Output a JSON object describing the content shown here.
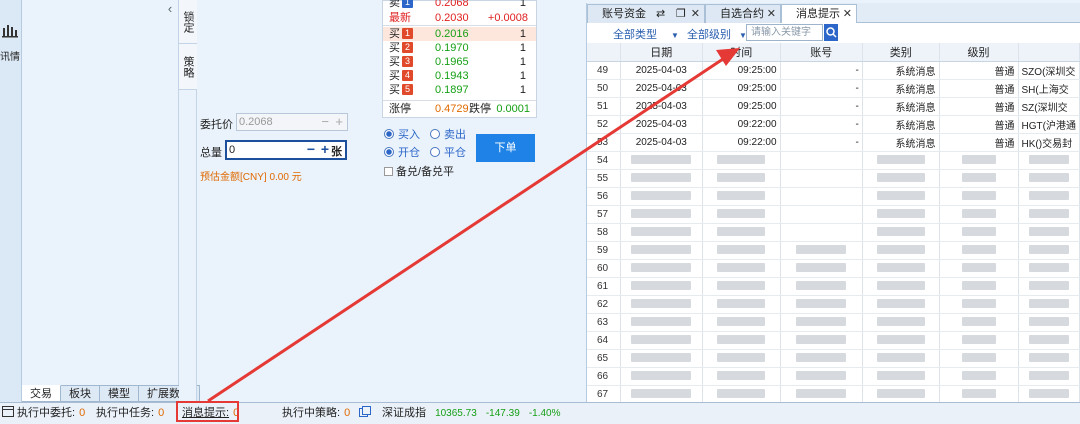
{
  "left_strip": {
    "label": "讯情"
  },
  "left_panel": {
    "bottom_tabs": [
      "交易",
      "板块",
      "模型",
      "扩展数据"
    ]
  },
  "vtabs": [
    "锁定",
    "策略"
  ],
  "order_book": {
    "top_sell": {
      "label": "卖",
      "tag": "1",
      "price": "0.2068",
      "vol": "1"
    },
    "latest": {
      "label": "最新",
      "price": "0.2030",
      "change": "+0.0008"
    },
    "buys": [
      {
        "label": "买",
        "tag": "1",
        "price": "0.2016",
        "vol": "1"
      },
      {
        "label": "买",
        "tag": "2",
        "price": "0.1970",
        "vol": "1"
      },
      {
        "label": "买",
        "tag": "3",
        "price": "0.1965",
        "vol": "1"
      },
      {
        "label": "买",
        "tag": "4",
        "price": "0.1943",
        "vol": "1"
      },
      {
        "label": "买",
        "tag": "5",
        "price": "0.1897",
        "vol": "1"
      }
    ],
    "limit_up_label": "涨停",
    "limit_up": "0.4729",
    "limit_down_label": "跌停",
    "limit_down": "0.0001",
    "colors": {
      "buy_row_bg": "#fde6dc",
      "sell_tag": "#2b66c8",
      "buy_tag": "#e04a2a"
    }
  },
  "order_form": {
    "price_label": "委托价",
    "price_value": "0.2068",
    "qty_label": "总量",
    "qty_value": "0",
    "qty_unit": "张",
    "estimate": "预估金额[CNY] 0.00 元",
    "side_buy": "买入",
    "side_sell": "卖出",
    "open": "开仓",
    "close": "平仓",
    "covered": "备兑/备兑平",
    "submit": "下单"
  },
  "grid": {
    "tabs": [
      "账号资金",
      "自选合约",
      "消息提示"
    ],
    "active_tab": "消息提示",
    "filters": {
      "type": "全部类型",
      "level": "全部级别",
      "search_placeholder": "请输入关键字"
    },
    "columns": [
      "日期",
      "时间",
      "账号",
      "类别",
      "级别",
      ""
    ],
    "rows": [
      {
        "seq": "49",
        "date": "2025-04-03",
        "time": "09:25:00",
        "account": "-",
        "cat": "系统消息",
        "level": "普通",
        "content": "SZO(深圳交"
      },
      {
        "seq": "50",
        "date": "2025-04-03",
        "time": "09:25:00",
        "account": "-",
        "cat": "系统消息",
        "level": "普通",
        "content": "SH(上海交"
      },
      {
        "seq": "51",
        "date": "2025-04-03",
        "time": "09:25:00",
        "account": "-",
        "cat": "系统消息",
        "level": "普通",
        "content": "SZ(深圳交"
      },
      {
        "seq": "52",
        "date": "2025-04-03",
        "time": "09:22:00",
        "account": "-",
        "cat": "系统消息",
        "level": "普通",
        "content": "HGT(沪港通"
      },
      {
        "seq": "53",
        "date": "2025-04-03",
        "time": "09:22:00",
        "account": "-",
        "cat": "系统消息",
        "level": "普通",
        "content": "HK()交易封"
      }
    ],
    "blurred_seqs": [
      "54",
      "55",
      "56",
      "57",
      "58",
      "59",
      "60",
      "61",
      "62",
      "63",
      "64",
      "65",
      "66",
      "67"
    ]
  },
  "status_bar": {
    "exec_orders_label": "执行中委托:",
    "exec_orders": "0",
    "exec_tasks_label": "执行中任务:",
    "exec_tasks": "0",
    "msg_label": "消息提示:",
    "msg_count": "0",
    "exec_strategy_label": "执行中策略:",
    "exec_strategy": "0",
    "index_name": "深证成指",
    "index_value": "10365.73",
    "index_change": "-147.39",
    "index_pct": "-1.40%"
  },
  "annotation": {
    "color": "#e53935"
  }
}
